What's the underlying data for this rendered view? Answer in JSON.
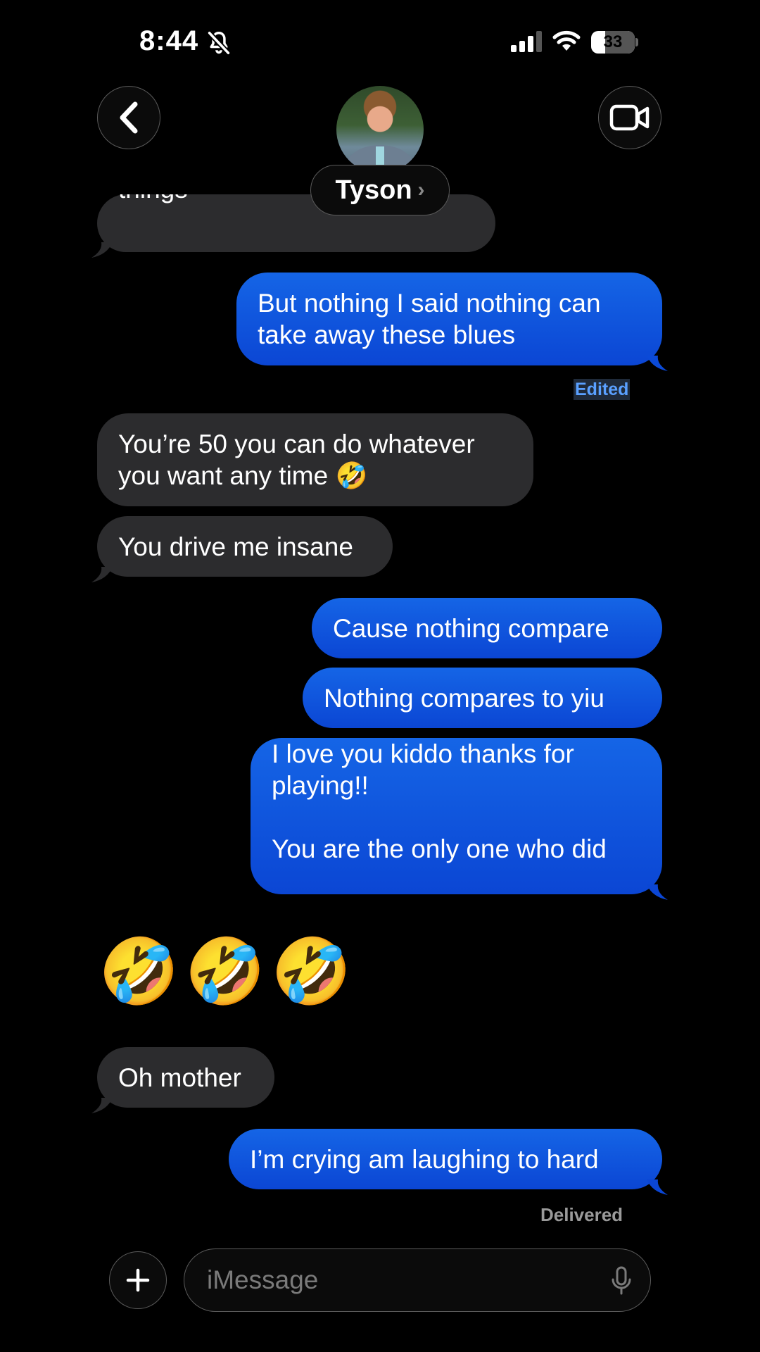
{
  "status_bar": {
    "time": "8:44",
    "battery_level": "33",
    "battery_fraction": 0.33,
    "icons": [
      "bell-off-icon",
      "signal-icon",
      "wifi-icon",
      "battery-icon"
    ]
  },
  "header": {
    "contact_name": "Tyson",
    "chevron": "›",
    "back_icon": "chevron-left-icon",
    "video_icon": "video-camera-icon"
  },
  "messages": [
    {
      "from": "contact",
      "text": "things",
      "partial": true
    },
    {
      "from": "me",
      "text": "But nothing I said nothing can\ntake away these blues",
      "status": "Edited"
    },
    {
      "from": "contact",
      "text": "You’re 50 you can do whatever\nyou want any time 🤣"
    },
    {
      "from": "contact",
      "text": "You drive me insane"
    },
    {
      "from": "me",
      "text": "Cause nothing compare"
    },
    {
      "from": "me",
      "text": "Nothing compares to yiu"
    },
    {
      "from": "me",
      "text": "I love you kiddo thanks for\nplaying!!\n\nYou are the only one who did"
    },
    {
      "from": "contact",
      "text": "🤣🤣🤣",
      "emoji_only": true
    },
    {
      "from": "contact",
      "text": "Oh mother"
    },
    {
      "from": "me",
      "text": "I’m crying am laughing to hard",
      "status": "Delivered"
    }
  ],
  "composer": {
    "placeholder": "iMessage",
    "plus_icon": "plus-icon",
    "mic_icon": "microphone-icon"
  },
  "colors": {
    "background": "#000000",
    "incoming_bubble": "#2c2c2e",
    "outgoing_bubble": "#0b57e0",
    "edited_label": "#5aa0ff"
  }
}
